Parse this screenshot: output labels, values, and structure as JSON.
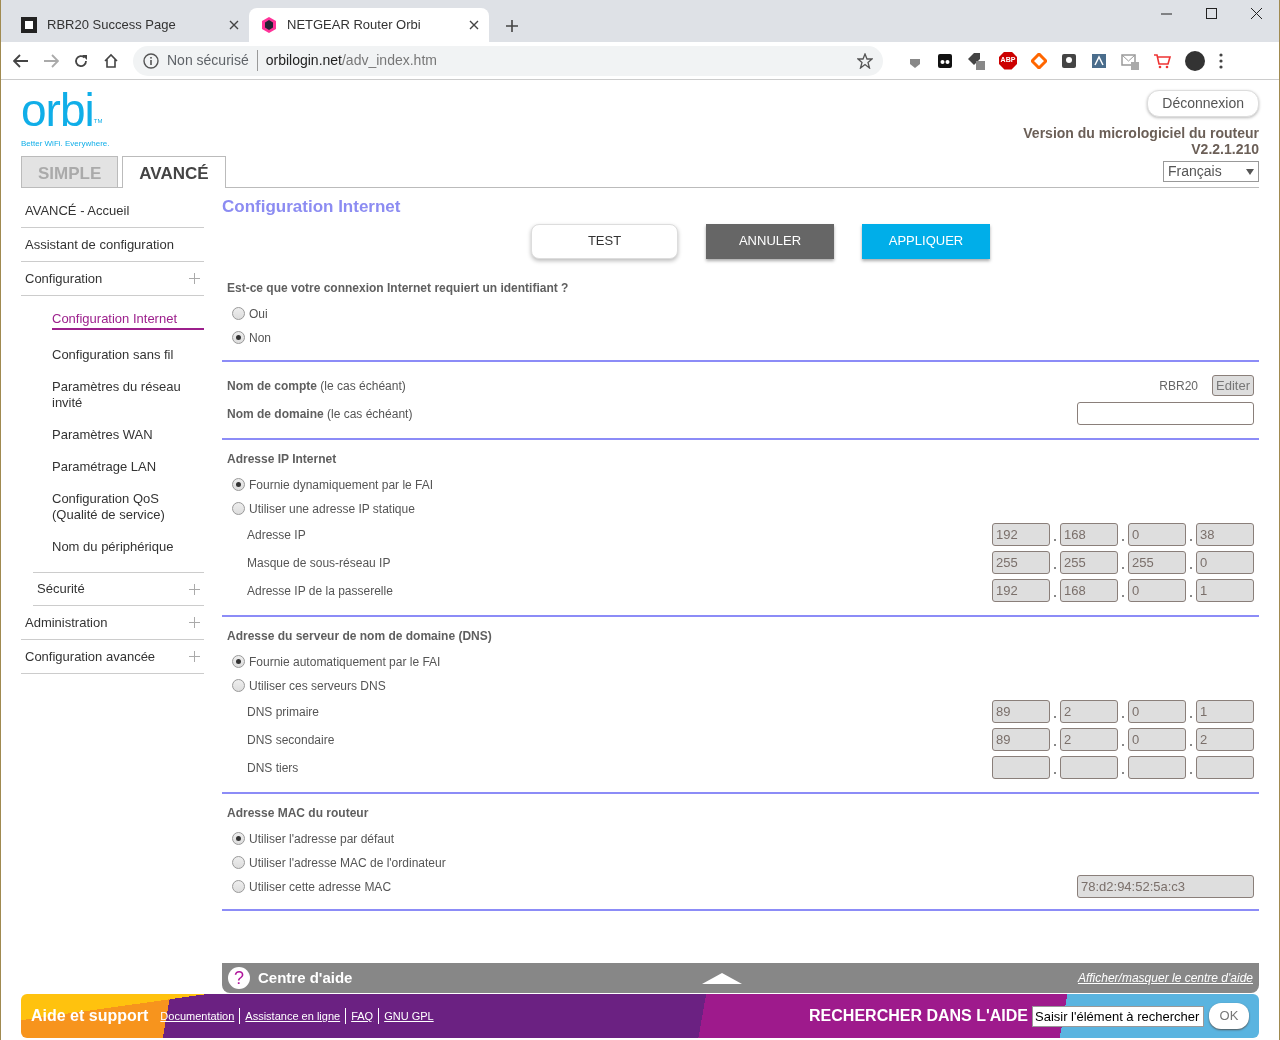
{
  "browser": {
    "tabs": [
      {
        "title": "RBR20 Success Page",
        "selected": false
      },
      {
        "title": "NETGEAR Router Orbi",
        "selected": true
      }
    ],
    "address": {
      "security": "Non sécurisé",
      "host": "orbilogin.net",
      "path": "/adv_index.htm"
    },
    "extension_badge": "ABP"
  },
  "header": {
    "logo": "orbi",
    "logo_mark": "TM",
    "tagline": "Better WiFi. Everywhere.",
    "logout": "Déconnexion",
    "firmware_label": "Version du micrologiciel du routeur",
    "firmware_version": "V2.2.1.210",
    "language": "Français"
  },
  "mode_tabs": [
    {
      "label": "SIMPLE",
      "selected": false
    },
    {
      "label": "AVANCÉ",
      "selected": true
    }
  ],
  "sidebar": {
    "items": [
      {
        "label": "AVANCÉ - Accueil",
        "kind": "top",
        "expandable": false
      },
      {
        "label": "Assistant de configuration",
        "kind": "top",
        "expandable": false
      },
      {
        "label": "Configuration",
        "kind": "top",
        "expandable": true,
        "children": [
          {
            "label": "Configuration Internet",
            "selected": true
          },
          {
            "label": "Configuration sans fil",
            "selected": false
          },
          {
            "label": "Paramètres du réseau invité",
            "selected": false
          },
          {
            "label": "Paramètres WAN",
            "selected": false
          },
          {
            "label": "Paramétrage LAN",
            "selected": false
          },
          {
            "label": "Configuration QoS (Qualité de service)",
            "selected": false
          },
          {
            "label": "Nom du périphérique",
            "selected": false
          }
        ]
      },
      {
        "label": "Sécurité",
        "kind": "top",
        "expandable": true
      },
      {
        "label": "Administration",
        "kind": "top",
        "expandable": true
      },
      {
        "label": "Configuration avancée",
        "kind": "top",
        "expandable": true
      }
    ]
  },
  "page": {
    "title": "Configuration Internet",
    "buttons": [
      {
        "label": "TEST",
        "kind": "light"
      },
      {
        "label": "ANNULER",
        "kind": "dark"
      },
      {
        "label": "APPLIQUER",
        "kind": "primary"
      }
    ],
    "sections": [
      {
        "title": "Est-ce que votre connexion Internet requiert un identifiant ?",
        "options": [
          {
            "label": "Oui",
            "selected": false
          },
          {
            "label": "Non",
            "selected": true
          }
        ]
      },
      {
        "rows": [
          {
            "kind": "account",
            "label": "Nom de compte",
            "hint": "(le cas échéant)",
            "value": "RBR20",
            "button": "Editer"
          },
          {
            "kind": "input",
            "label": "Nom de domaine",
            "hint": "(le cas échéant)",
            "disabled": false
          }
        ]
      },
      {
        "title": "Adresse IP Internet",
        "options": [
          {
            "label": "Fournie dynamiquement par le FAI",
            "selected": true
          },
          {
            "label": "Utiliser une adresse IP statique",
            "selected": false
          }
        ],
        "rows": [
          {
            "kind": "octets",
            "label": "Adresse IP",
            "octets": [
              "192",
              "168",
              "0",
              "38"
            ],
            "disabled": true
          },
          {
            "kind": "octets",
            "label": "Masque de sous-réseau IP",
            "octets": [
              "255",
              "255",
              "255",
              "0"
            ],
            "disabled": true
          },
          {
            "kind": "octets",
            "label": "Adresse IP de la passerelle",
            "octets": [
              "192",
              "168",
              "0",
              "1"
            ],
            "disabled": true
          }
        ]
      },
      {
        "title": "Adresse du serveur de nom de domaine (DNS)",
        "options": [
          {
            "label": "Fournie automatiquement par le FAI",
            "selected": true
          },
          {
            "label": "Utiliser ces serveurs DNS",
            "selected": false
          }
        ],
        "rows": [
          {
            "kind": "octets",
            "label": "DNS primaire",
            "octets": [
              "89",
              "2",
              "0",
              "1"
            ],
            "disabled": true
          },
          {
            "kind": "octets",
            "label": "DNS secondaire",
            "octets": [
              "89",
              "2",
              "0",
              "2"
            ],
            "disabled": true
          },
          {
            "kind": "octets_blank",
            "label": "DNS tiers",
            "disabled": true
          }
        ]
      },
      {
        "title": "Adresse MAC du routeur",
        "options": [
          {
            "label": "Utiliser l'adresse par défaut",
            "selected": true
          },
          {
            "label": "Utiliser l'adresse MAC de l'ordinateur",
            "selected": false
          },
          {
            "label": "Utiliser cette adresse MAC",
            "selected": false,
            "value": "78:d2:94:52:5a:c3",
            "disabled": true
          }
        ]
      }
    ]
  },
  "help": {
    "icon": "?",
    "title": "Centre d'aide",
    "toggle": "Afficher/masquer le centre d'aide"
  },
  "footer": {
    "title": "Aide et support",
    "links": [
      "Documentation",
      "Assistance en ligne",
      "FAQ",
      "GNU GPL"
    ],
    "search_label": "RECHERCHER DANS L'AIDE",
    "search_placeholder": "Saisir l'élément à rechercher",
    "search_button": "OK"
  }
}
